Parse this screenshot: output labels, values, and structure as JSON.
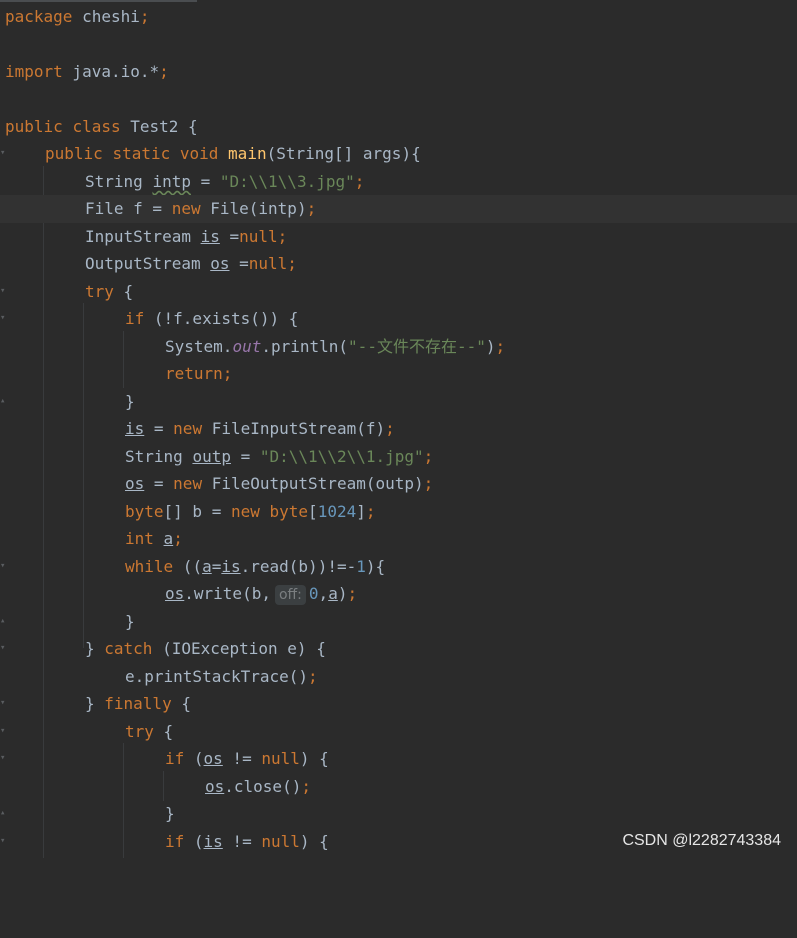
{
  "watermark": "CSDN @l2282743384",
  "code": {
    "l1_kw": "package",
    "l1_rest": " cheshi",
    "l2_kw": "import",
    "l2_rest": " java.io.*",
    "l3_kw1": "public",
    "l3_kw2": "class",
    "l3_rest": " Test2 {",
    "l4_kw1": "public",
    "l4_kw2": "static",
    "l4_kw3": "void",
    "l4_fn": "main",
    "l4_rest": "(String[] args){",
    "l5_type": "String ",
    "l5_var": "intp",
    "l5_eq": " = ",
    "l5_str": "\"D:\\\\1\\\\3.jpg\"",
    "l6_a": "File f = ",
    "l6_kw": "new",
    "l6_b": " File(intp)",
    "l7_a": "InputStream ",
    "l7_var": "is",
    "l7_b": " =",
    "l7_kw": "null",
    "l8_a": "OutputStream ",
    "l8_var": "os",
    "l8_b": " =",
    "l8_kw": "null",
    "l9_kw": "try",
    "l9_b": " {",
    "l10_kw": "if",
    "l10_b": " (!f.exists()) {",
    "l11_a": "System.",
    "l11_fld": "out",
    "l11_b": ".println(",
    "l11_str": "\"--文件不存在--\"",
    "l11_c": ")",
    "l12_kw": "return",
    "l13": "}",
    "l14_var": "is",
    "l14_a": " = ",
    "l14_kw": "new",
    "l14_b": " FileInputStream(f)",
    "l15_a": "String ",
    "l15_var": "outp",
    "l15_b": " = ",
    "l15_str": "\"D:\\\\1\\\\2\\\\1.jpg\"",
    "l16_var": "os",
    "l16_a": " = ",
    "l16_kw": "new",
    "l16_b": " FileOutputStream(outp)",
    "l17_kw1": "byte",
    "l17_a": "[] b = ",
    "l17_kw2": "new",
    "l17_kw3": "byte",
    "l17_b": "[",
    "l17_num": "1024",
    "l17_c": "]",
    "l18_kw": "int",
    "l18_var": "a",
    "l19_kw": "while",
    "l19_a": " ((",
    "l19_v1": "a",
    "l19_b": "=",
    "l19_v2": "is",
    "l19_c": ".read(b))!=-",
    "l19_num": "1",
    "l19_d": "){",
    "l20_var": "os",
    "l20_a": ".write(b,",
    "l20_hint": "off:",
    "l20_num": "0",
    "l20_b": ",",
    "l20_v": "a",
    "l20_c": ")",
    "l21": "}",
    "l22_a": "} ",
    "l22_kw": "catch",
    "l22_b": " (IOException e) {",
    "l23_a": "e.printStackTrace()",
    "l24_a": "} ",
    "l24_kw": "finally",
    "l24_b": " {",
    "l25_kw": "try",
    "l25_b": " {",
    "l26_kw": "if",
    "l26_a": " (",
    "l26_var": "os",
    "l26_b": " != ",
    "l26_kw2": "null",
    "l26_c": ") {",
    "l27_var": "os",
    "l27_a": ".close()",
    "l28": "}",
    "l29_kw": "if",
    "l29_a": " (",
    "l29_var": "is",
    "l29_b": " != ",
    "l29_kw2": "null",
    "l29_c": ") {",
    "semicolon": ";",
    "comma": ",",
    "space": " "
  }
}
